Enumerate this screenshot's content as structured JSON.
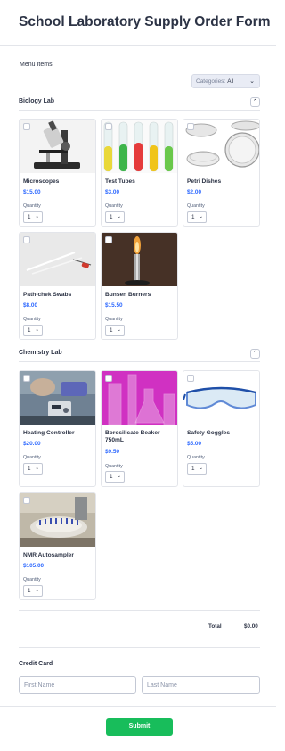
{
  "form": {
    "title": "School Laboratory Supply Order Form",
    "menu_label": "Menu Items",
    "categories": {
      "prefix": "Categories:",
      "value": "All"
    }
  },
  "sections": {
    "biology": {
      "title": "Biology Lab"
    },
    "chemistry": {
      "title": "Chemistry Lab"
    }
  },
  "products": {
    "microscopes": {
      "name": "Microscopes",
      "price": "$15.00",
      "qty_label": "Quantity",
      "qty": "1"
    },
    "test_tubes": {
      "name": "Test Tubes",
      "price": "$3.00",
      "qty_label": "Quantity",
      "qty": "1"
    },
    "petri": {
      "name": "Petri Dishes",
      "price": "$2.00",
      "qty_label": "Quantity",
      "qty": "1"
    },
    "swabs": {
      "name": "Path-chek Swabs",
      "price": "$8.00",
      "qty_label": "Quantity",
      "qty": "1"
    },
    "bunsen": {
      "name": "Bunsen Burners",
      "price": "$15.50",
      "qty_label": "Quantity",
      "qty": "1"
    },
    "heating": {
      "name": "Heating Controller",
      "price": "$20.00",
      "qty_label": "Quantity",
      "qty": "1"
    },
    "beaker": {
      "name": "Borosilicate Beaker 750mL",
      "price": "$9.50",
      "qty_label": "Quantity",
      "qty": "1"
    },
    "goggles": {
      "name": "Safety Goggles",
      "price": "$5.00",
      "qty_label": "Quantity",
      "qty": "1"
    },
    "nmr": {
      "name": "NMR Autosampler",
      "price": "$105.00",
      "qty_label": "Quantity",
      "qty": "1"
    }
  },
  "total": {
    "label": "Total",
    "value": "$0.00"
  },
  "credit_card": {
    "label": "Credit Card",
    "first_name_placeholder": "First Name",
    "last_name_placeholder": "Last Name"
  },
  "submit_label": "Submit",
  "colors": {
    "accent": "#2e69ff",
    "submit": "#18bd5b",
    "text": "#2c3345"
  }
}
